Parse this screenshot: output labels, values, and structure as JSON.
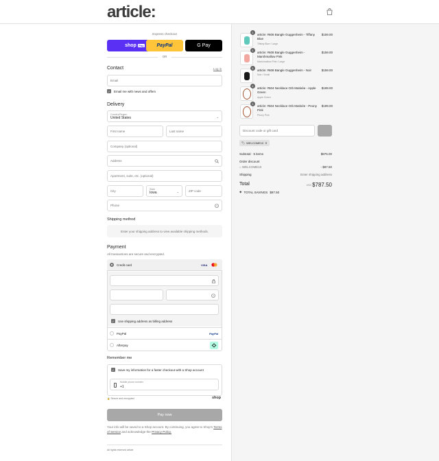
{
  "header": {
    "logo": "article:",
    "cart_icon": "shopping-bag-icon"
  },
  "express": {
    "label": "Express checkout",
    "shop_label": "shop",
    "shop_badge": "Pay",
    "paypal_label": "PayPal",
    "gpay_label": "G Pay",
    "or_label": "OR"
  },
  "contact": {
    "title": "Contact",
    "login_link": "Log in",
    "email_placeholder": "Email",
    "news_label": "Email me with news and offers"
  },
  "delivery": {
    "title": "Delivery",
    "country_label": "Country/Region",
    "country_value": "United States",
    "first_name": "First name",
    "last_name": "Last name",
    "company": "Company (optional)",
    "address": "Address",
    "apartment": "Apartment, suite, etc. (optional)",
    "city": "City",
    "state_label": "State",
    "state_value": "Iowa",
    "zip": "ZIP code",
    "phone": "Phone"
  },
  "shipping_method": {
    "title": "Shipping method",
    "message": "Enter your shipping address to view available shipping methods."
  },
  "payment": {
    "title": "Payment",
    "subtitle": "All transactions are secure and encrypted.",
    "credit_card_label": "Credit card",
    "visa": "VISA",
    "billing_label": "Use shipping address as billing address",
    "paypal_label": "PayPal",
    "paypal_badge": "PayPal",
    "afterpay_label": "Afterpay"
  },
  "remember": {
    "title": "Remember me",
    "save_label": "Save my information for a faster checkout with a Shop account",
    "phone_label": "Mobile phone number",
    "phone_value": "+1",
    "secure_label": "Secure and encrypted",
    "shop_word": "shop"
  },
  "pay_now": "Pay now",
  "legal": {
    "text": "Your info will be saved to a Shop account. By continuing, you agree to Shop's",
    "terms": "Terms of Service",
    "and": "and acknowledge the",
    "privacy": "Privacy Policy."
  },
  "footer": "All rights reserved article",
  "cart": {
    "items": [
      {
        "qty": "1",
        "name": "article: #606 Bangle Guggenheim - Tiffany Blue",
        "variant": "Tiffany Blue / Large",
        "price": "$159.00",
        "color": "#5fc9bb",
        "kind": "bangle"
      },
      {
        "qty": "1",
        "name": "article: #608 Bangle Guggenheim - Marshmallow Pink",
        "variant": "Marshmallow Pink / Large",
        "price": "$159.00",
        "color": "#f3a7a1",
        "kind": "bangle"
      },
      {
        "qty": "1",
        "name": "article: #608 Bangle Guggenheim - Noir",
        "variant": "Noir / Small",
        "price": "$159.00",
        "color": "#1a1a1a",
        "kind": "bangle"
      },
      {
        "qty": "1",
        "name": "article: #504 Necklace Orb Matinée - Apple Green",
        "variant": "Apple Green",
        "price": "$199.00",
        "color": "#a0522d",
        "kind": "necklace"
      },
      {
        "qty": "1",
        "name": "article: #504 Necklace Orb Matinée - Peony Pink",
        "variant": "Peony Pink",
        "price": "$199.00",
        "color": "#a0522d",
        "kind": "necklace"
      }
    ],
    "discount_placeholder": "Discount code or gift card",
    "code": "WELCOME10",
    "subtotal_label": "Subtotal · 5 items",
    "subtotal_value": "$875.00",
    "order_discount_label": "Order discount",
    "discount_code": "WELCOME10",
    "discount_value": "- $87.50",
    "shipping_label": "Shipping",
    "shipping_value": "Enter shipping address",
    "total_label": "Total",
    "currency": "USD",
    "total_value": "$787.50",
    "savings_label": "TOTAL SAVINGS",
    "savings_value": "$87.50"
  }
}
